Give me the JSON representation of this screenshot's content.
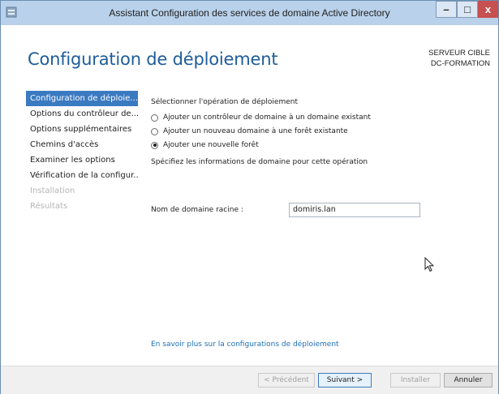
{
  "window": {
    "title": "Assistant Configuration des services de domaine Active Directory",
    "minimize": "–",
    "maximize": "□",
    "close": "x"
  },
  "page": {
    "title": "Configuration de déploiement",
    "server_label": "SERVEUR CIBLE",
    "server_name": "DC-FORMATION"
  },
  "nav": {
    "items": [
      {
        "label": "Configuration de déploie...",
        "state": "active"
      },
      {
        "label": "Options du contrôleur de...",
        "state": "normal"
      },
      {
        "label": "Options supplémentaires",
        "state": "normal"
      },
      {
        "label": "Chemins d'accès",
        "state": "normal"
      },
      {
        "label": "Examiner les options",
        "state": "normal"
      },
      {
        "label": "Vérification de la configur...",
        "state": "normal"
      },
      {
        "label": "Installation",
        "state": "disabled"
      },
      {
        "label": "Résultats",
        "state": "disabled"
      }
    ]
  },
  "main": {
    "operation_heading": "Sélectionner l'opération de déploiement",
    "options": [
      {
        "label": "Ajouter un contrôleur de domaine à un domaine existant",
        "checked": false
      },
      {
        "label": "Ajouter un nouveau domaine à une forêt existante",
        "checked": false
      },
      {
        "label": "Ajouter une nouvelle forêt",
        "checked": true
      }
    ],
    "domain_heading": "Spécifiez les informations de domaine pour cette opération",
    "root_domain_label": "Nom de domaine racine :",
    "root_domain_value": "domiris.lan",
    "learn_more": "En savoir plus sur la configurations de déploiement"
  },
  "footer": {
    "previous": "< Précédent",
    "next": "Suivant >",
    "install": "Installer",
    "cancel": "Annuler"
  },
  "colors": {
    "accent": "#3a7ac1",
    "title_blue": "#1e5c99",
    "titlebar": "#b9d1ea",
    "close_red": "#c75050"
  }
}
